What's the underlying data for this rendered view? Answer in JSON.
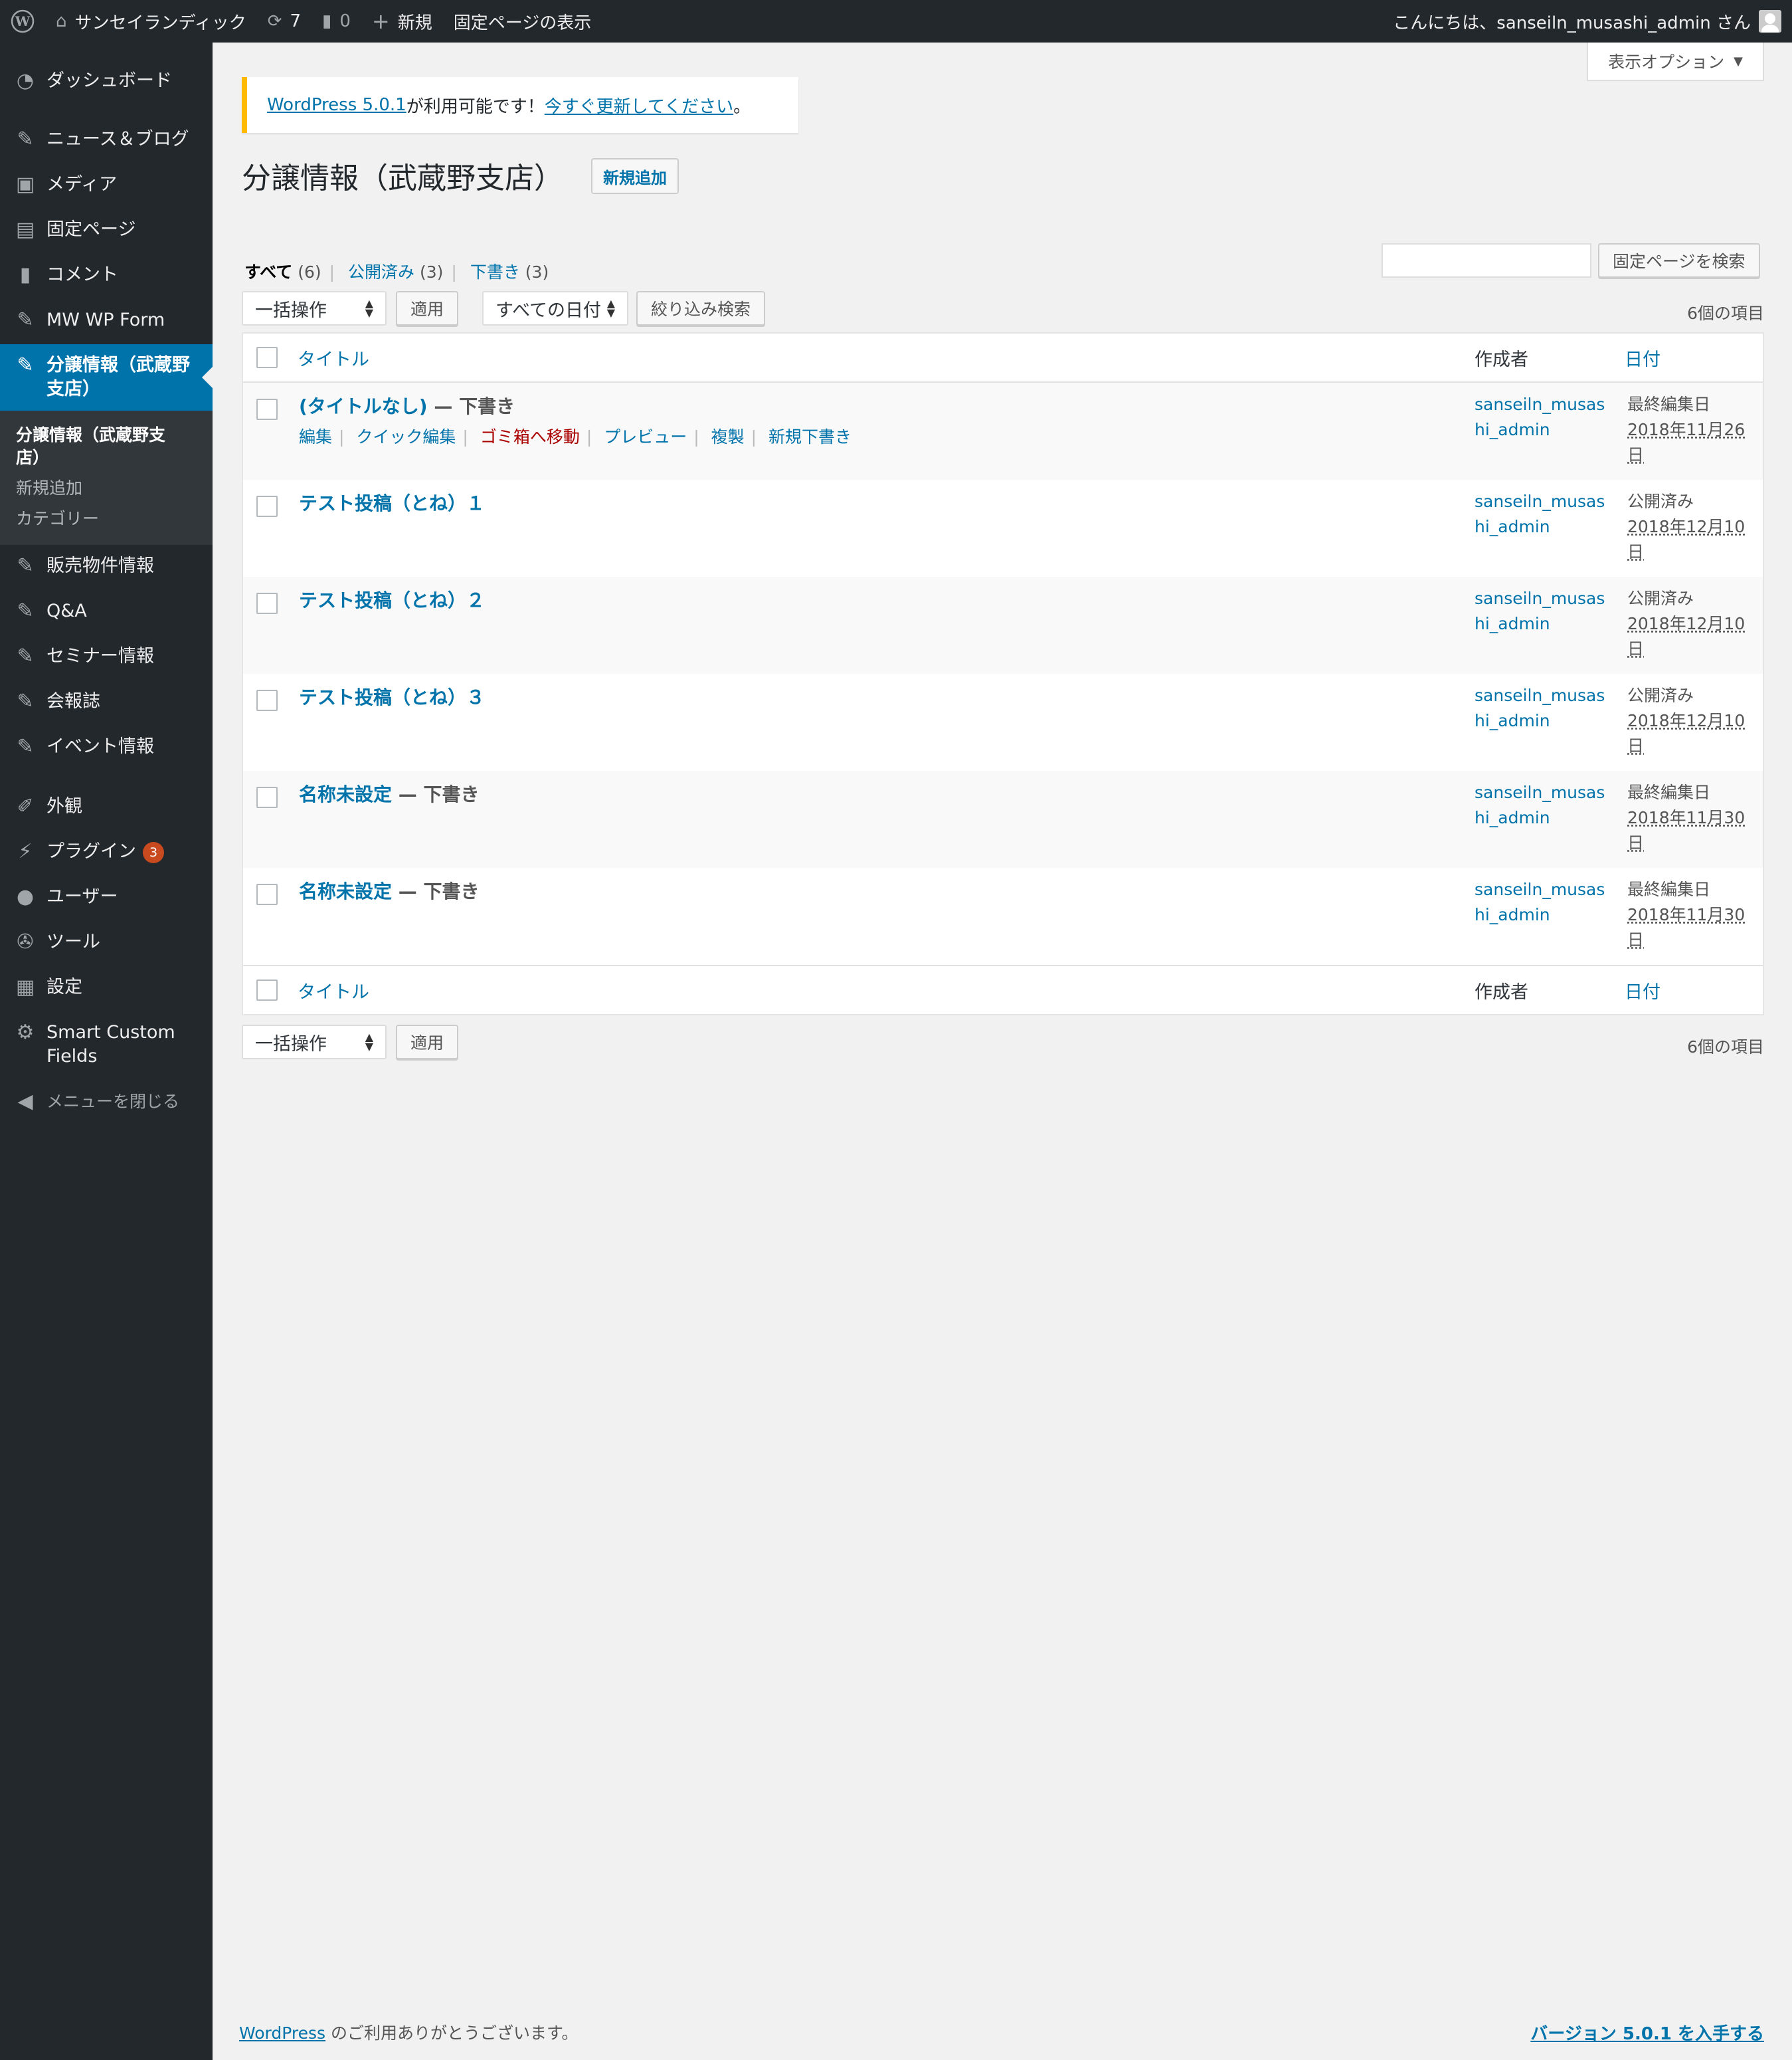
{
  "adminbar": {
    "site_name": "サンセイランディック",
    "updates_count": "7",
    "comments_count": "0",
    "new_label": "新規",
    "view_page": "固定ページの表示",
    "greeting": "こんにちは、sanseiln_musashi_admin さん"
  },
  "sidebar": {
    "dashboard": "ダッシュボード",
    "news_blog": "ニュース＆ブログ",
    "media": "メディア",
    "pages": "固定ページ",
    "comments": "コメント",
    "mw_wp_form": "MW WP Form",
    "current": "分譲情報（武蔵野支店）",
    "sub_current": "分譲情報（武蔵野支店）",
    "sub_add_new": "新規追加",
    "sub_category": "カテゴリー",
    "sales": "販売物件情報",
    "qa": "Q&A",
    "seminar": "セミナー情報",
    "newsletter": "会報誌",
    "events": "イベント情報",
    "appearance": "外観",
    "plugins": "プラグイン",
    "plugins_badge": "3",
    "users": "ユーザー",
    "tools": "ツール",
    "settings": "設定",
    "scf": "Smart Custom Fields",
    "collapse": "メニューを閉じる"
  },
  "screen_options": "表示オプション",
  "notice": {
    "link_version": "WordPress 5.0.1",
    "text": " が利用可能です！",
    "link_update": "今すぐ更新してください",
    "end": "。"
  },
  "page": {
    "title": "分譲情報（武蔵野支店）",
    "add_new": "新規追加"
  },
  "filters": {
    "all_label": "すべて",
    "all_count": "(6)",
    "published_label": "公開済み",
    "published_count": "(3)",
    "draft_label": "下書き",
    "draft_count": "(3)",
    "search_button": "固定ページを検索",
    "bulk_action": "一括操作",
    "apply": "適用",
    "all_dates": "すべての日付",
    "filter_button": "絞り込み検索",
    "items_count": "6個の項目"
  },
  "table": {
    "col_title": "タイトル",
    "col_author": "作成者",
    "col_date": "日付",
    "rows": [
      {
        "title": "(タイトルなし)",
        "state": " — 下書き",
        "author": "sanseiln_musashi_admin",
        "date_status": "最終編集日",
        "date": "2018年11月26日"
      },
      {
        "title": "テスト投稿（とね）１",
        "state": "",
        "author": "sanseiln_musashi_admin",
        "date_status": "公開済み",
        "date": "2018年12月10日"
      },
      {
        "title": "テスト投稿（とね）２",
        "state": "",
        "author": "sanseiln_musashi_admin",
        "date_status": "公開済み",
        "date": "2018年12月10日"
      },
      {
        "title": "テスト投稿（とね）３",
        "state": "",
        "author": "sanseiln_musashi_admin",
        "date_status": "公開済み",
        "date": "2018年12月10日"
      },
      {
        "title": "名称未設定",
        "state": " — 下書き",
        "author": "sanseiln_musashi_admin",
        "date_status": "最終編集日",
        "date": "2018年11月30日"
      },
      {
        "title": "名称未設定",
        "state": " — 下書き",
        "author": "sanseiln_musashi_admin",
        "date_status": "最終編集日",
        "date": "2018年11月30日"
      }
    ],
    "row_actions": {
      "edit": "編集",
      "quick_edit": "クイック編集",
      "trash": "ゴミ箱へ移動",
      "preview": "プレビュー",
      "duplicate": "複製",
      "new_draft": "新規下書き"
    }
  },
  "footer": {
    "wp_link": "WordPress",
    "thanks": " のご利用ありがとうございます。",
    "version": "バージョン 5.0.1 を入手する"
  }
}
